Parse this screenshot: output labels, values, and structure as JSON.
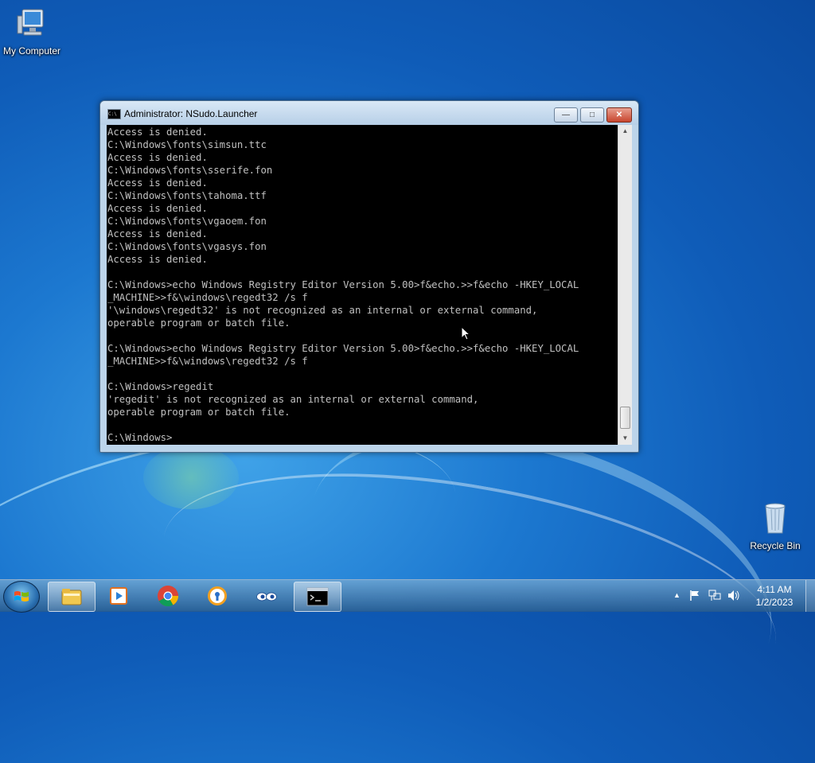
{
  "desktop": {
    "icons": [
      {
        "label": "My Computer"
      },
      {
        "label": "Recycle Bin"
      }
    ]
  },
  "console_window": {
    "title": "Administrator: NSudo.Launcher",
    "buttons": {
      "minimize": "—",
      "maximize": "□",
      "close": "✕"
    },
    "output": "Access is denied.\nC:\\Windows\\fonts\\simsun.ttc\nAccess is denied.\nC:\\Windows\\fonts\\sserife.fon\nAccess is denied.\nC:\\Windows\\fonts\\tahoma.ttf\nAccess is denied.\nC:\\Windows\\fonts\\vgaoem.fon\nAccess is denied.\nC:\\Windows\\fonts\\vgasys.fon\nAccess is denied.\n\nC:\\Windows>echo Windows Registry Editor Version 5.00>f&echo.>>f&echo -HKEY_LOCAL\n_MACHINE>>f&\\windows\\regedt32 /s f\n'\\windows\\regedt32' is not recognized as an internal or external command,\noperable program or batch file.\n\nC:\\Windows>echo Windows Registry Editor Version 5.00>f&echo.>>f&echo -HKEY_LOCAL\n_MACHINE>>f&\\windows\\regedt32 /s f\n\nC:\\Windows>regedit\n'regedit' is not recognized as an internal or external command,\noperable program or batch file.\n\nC:\\Windows>"
  },
  "taskbar": {
    "items": [
      {
        "name": "windows-explorer"
      },
      {
        "name": "media-player"
      },
      {
        "name": "chrome"
      },
      {
        "name": "security-app"
      },
      {
        "name": "eyes-app"
      },
      {
        "name": "command-prompt",
        "active": true
      }
    ],
    "tray": {
      "show_hidden": "▲"
    },
    "clock": {
      "time": "4:11 AM",
      "date": "1/2/2023"
    }
  },
  "colors": {
    "desktop_blue": "#1c78d0",
    "console_bg": "#000000",
    "console_text": "#c0c0c0"
  }
}
